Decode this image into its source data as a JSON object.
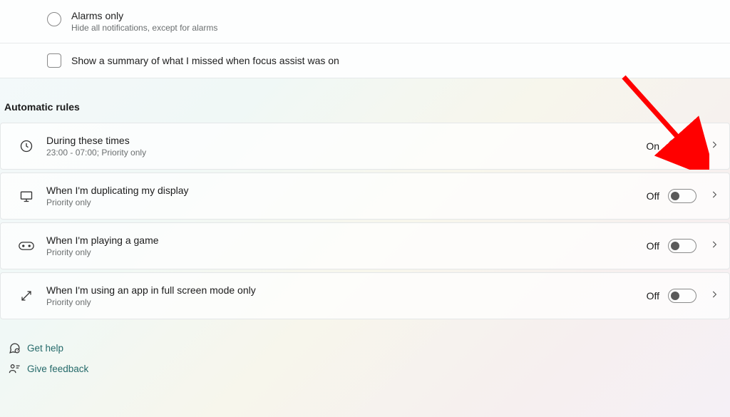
{
  "focus_options": {
    "alarms_only": {
      "title": "Alarms only",
      "subtitle": "Hide all notifications, except for alarms"
    },
    "summary_checkbox_label": "Show a summary of what I missed when focus assist was on"
  },
  "section_title": "Automatic rules",
  "rules": [
    {
      "title": "During these times",
      "subtitle": "23:00 - 07:00; Priority only",
      "state": "On",
      "on": true
    },
    {
      "title": "When I'm duplicating my display",
      "subtitle": "Priority only",
      "state": "Off",
      "on": false
    },
    {
      "title": "When I'm playing a game",
      "subtitle": "Priority only",
      "state": "Off",
      "on": false
    },
    {
      "title": "When I'm using an app in full screen mode only",
      "subtitle": "Priority only",
      "state": "Off",
      "on": false
    }
  ],
  "footer": {
    "help": "Get help",
    "feedback": "Give feedback"
  }
}
